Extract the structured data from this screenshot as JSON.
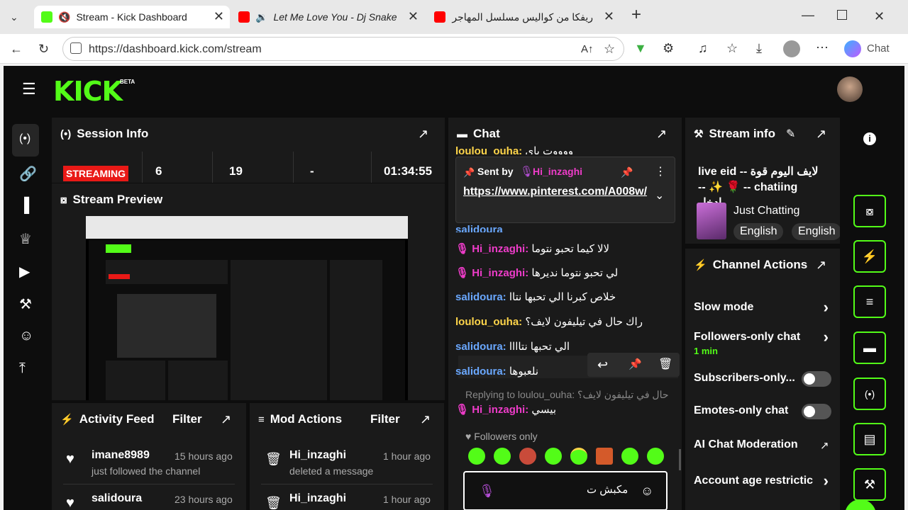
{
  "browser": {
    "tabs": [
      {
        "title": "Stream - Kick Dashboard",
        "favicon_color": "#53fc18"
      },
      {
        "title": "Let Me Love You - Dj Snake",
        "favicon_color": "#ff0000"
      },
      {
        "title": "ريفكا من كواليس مسلسل المهاجر - e",
        "favicon_color": "#ff0000"
      }
    ],
    "new_tab": "+",
    "url": "https://dashboard.kick.com/stream",
    "copilot_label": "Chat"
  },
  "app": {
    "logo": "KICK",
    "logo_badge": "BETA",
    "session": {
      "title": "Session Info",
      "status": "STREAMING",
      "stats": [
        "6",
        "19",
        "-",
        "01:34:55"
      ]
    },
    "preview": {
      "title": "Stream Preview"
    },
    "activity": {
      "title": "Activity Feed",
      "filter": "Filter",
      "items": [
        {
          "name": "imane8989",
          "desc": "just followed the channel",
          "time": "15 hours ago"
        },
        {
          "name": "salidoura",
          "time": "23 hours ago"
        }
      ]
    },
    "mod_actions": {
      "title": "Mod Actions",
      "filter": "Filter",
      "items": [
        {
          "name": "Hi_inzaghi",
          "desc": "deleted a message",
          "time": "1 hour ago"
        },
        {
          "name": "Hi_inzaghi",
          "time": "1 hour ago"
        }
      ]
    },
    "chat": {
      "title": "Chat",
      "top_user": "loulou_ouha:",
      "top_msg": "ووووت باي",
      "pinned": {
        "sent_by_label": "Sent by",
        "user": "Hi_inzaghi",
        "link": "https://www.pinterest.com/A008w/"
      },
      "partial_user": "salidoura",
      "messages": [
        {
          "user": "Hi_inzaghi:",
          "text": "لالا كيما تحبو نتوما",
          "color": "mag"
        },
        {
          "user": "Hi_inzaghi:",
          "text": "لي تحبو نتوما نديرها",
          "color": "mag"
        },
        {
          "user": "salidoura:",
          "text": "خلاص كبرنا الي تحبها نتاا",
          "color": "blue"
        },
        {
          "user": "loulou_ouha:",
          "text": "راك حال في تيليفون لايف؟",
          "color": "yel"
        },
        {
          "user": "salidoura:",
          "text": "الي تحبها نتاااا",
          "color": "blue"
        },
        {
          "user": "salidoura:",
          "text": "نلعبوها",
          "color": "blue"
        }
      ],
      "reply_to": "Replying to loulou_ouha: راك حال في تيليفون لايف؟...",
      "reply_user": "Hi_inzaghi:",
      "reply_text": "بيسي",
      "followers_only": "Followers only",
      "input_value": "مكبش ت"
    },
    "stream_info": {
      "title": "Stream info",
      "stream_title": "لايف اليوم قوة -- live eid -- chatiing 🌹 ✨ -- ادخل",
      "category": "Just Chatting",
      "tags": [
        "English",
        "English"
      ]
    },
    "channel_actions": {
      "title": "Channel Actions",
      "items": [
        {
          "label": "Slow mode"
        },
        {
          "label": "Followers-only chat",
          "sub": "1 min"
        },
        {
          "label": "Subscribers-only..."
        },
        {
          "label": "Emotes-only chat"
        },
        {
          "label": "AI Chat Moderation"
        },
        {
          "label": "Account age restrictic"
        }
      ]
    }
  }
}
